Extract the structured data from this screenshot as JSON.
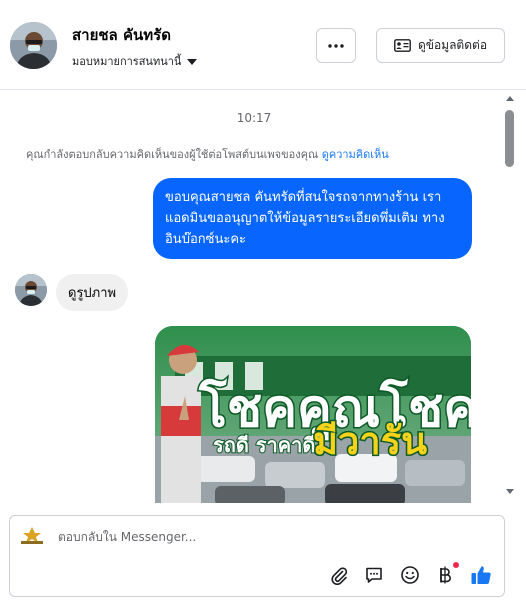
{
  "header": {
    "contact_name": "สายชล คันทรัด",
    "assign_label": "มอบหมายการสนทนานี้",
    "more_label": "···",
    "details_label": "ดูข้อมูลติดต่อ"
  },
  "thread": {
    "timestamp": "10:17",
    "context_text": "คุณกำลังตอบกลับความคิดเห็นของผู้ใช้ต่อโพสต์บนเพจของคุณ",
    "context_link": "ดูความคิดเห็น",
    "outgoing_message": "ขอบคุณสายชล คันทรัดที่สนใจรถจากทางร้าน เรา แอดมินขออนุญาตให้ข้อมูลรายระเอียดพึ่มเติม ทางอินบ๊อกซ์นะคะ",
    "incoming_message": "ดูรูปภาพ",
    "image_text_line1": "โชคคูณโชค",
    "image_text_line2": "รถดี ราคาดี",
    "image_text_line3": "มีวารัน"
  },
  "composer": {
    "placeholder": "ตอบกลับใน Messenger..."
  },
  "colors": {
    "accent": "#0866ff",
    "link": "#1877f2",
    "incoming_bubble": "#f0f0f0",
    "like": "#1877f2"
  },
  "icons": [
    "more-icon",
    "contact-card-icon",
    "caret-down-icon",
    "paperclip-icon",
    "saved-replies-icon",
    "emoji-icon",
    "baht-icon",
    "thumbs-up-icon"
  ]
}
